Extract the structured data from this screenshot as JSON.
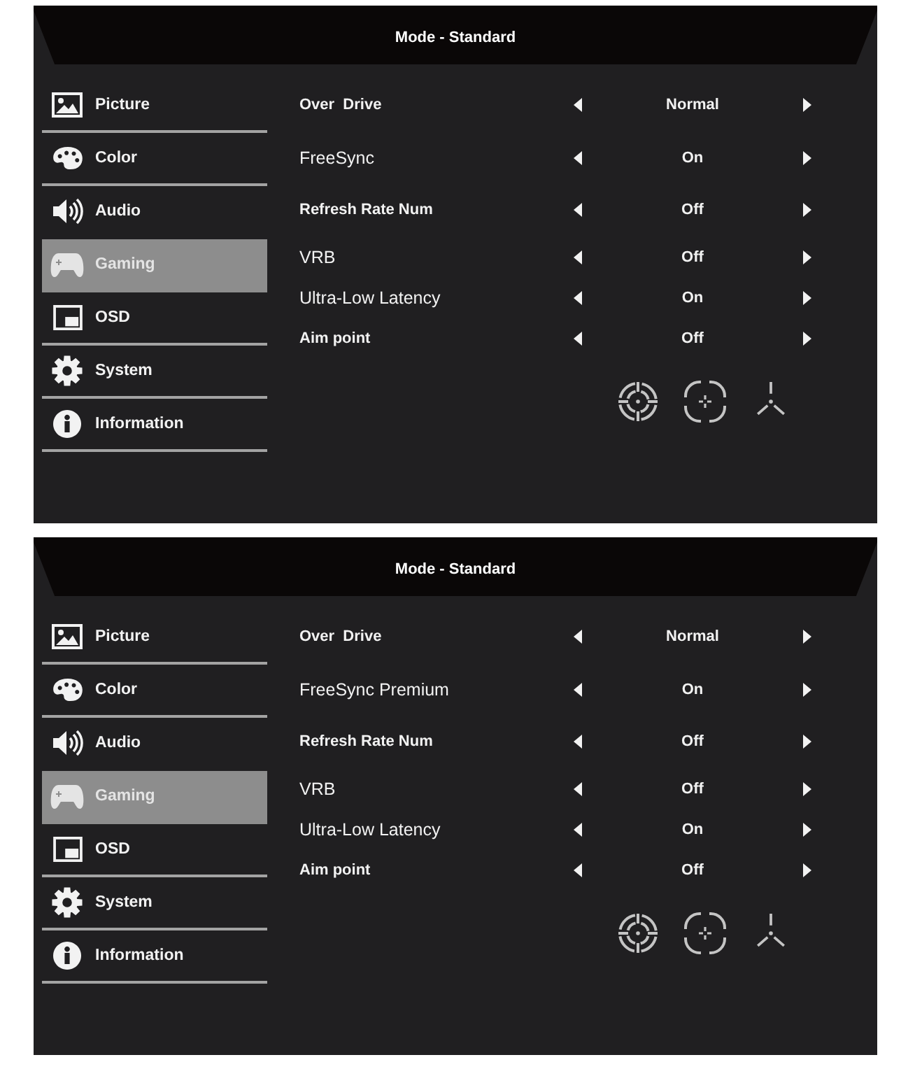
{
  "panels": [
    {
      "title": "Mode - Standard",
      "menu": [
        {
          "label": "Picture",
          "selected": false
        },
        {
          "label": "Color",
          "selected": false
        },
        {
          "label": "Audio",
          "selected": false
        },
        {
          "label": "Gaming",
          "selected": true
        },
        {
          "label": "OSD",
          "selected": false
        },
        {
          "label": "System",
          "selected": false
        },
        {
          "label": "Information",
          "selected": false
        }
      ],
      "settings": [
        {
          "label": "Over  Drive",
          "bold": true,
          "value": "Normal"
        },
        {
          "label": "FreeSync",
          "bold": false,
          "value": "On"
        },
        {
          "label": "Refresh Rate Num",
          "bold": true,
          "value": "Off"
        },
        {
          "label": "VRB",
          "bold": false,
          "value": "Off"
        },
        {
          "label": "Ultra-Low Latency",
          "bold": false,
          "value": "On"
        },
        {
          "label": "Aim point",
          "bold": true,
          "value": "Off"
        }
      ]
    },
    {
      "title": "Mode - Standard",
      "menu": [
        {
          "label": "Picture",
          "selected": false
        },
        {
          "label": "Color",
          "selected": false
        },
        {
          "label": "Audio",
          "selected": false
        },
        {
          "label": "Gaming",
          "selected": true
        },
        {
          "label": "OSD",
          "selected": false
        },
        {
          "label": "System",
          "selected": false
        },
        {
          "label": "Information",
          "selected": false
        }
      ],
      "settings": [
        {
          "label": "Over  Drive",
          "bold": true,
          "value": "Normal"
        },
        {
          "label": "FreeSync Premium",
          "bold": false,
          "value": "On"
        },
        {
          "label": "Refresh Rate Num",
          "bold": true,
          "value": "Off"
        },
        {
          "label": "VRB",
          "bold": false,
          "value": "Off"
        },
        {
          "label": "Ultra-Low Latency",
          "bold": false,
          "value": "On"
        },
        {
          "label": "Aim point",
          "bold": true,
          "value": "Off"
        }
      ]
    }
  ]
}
